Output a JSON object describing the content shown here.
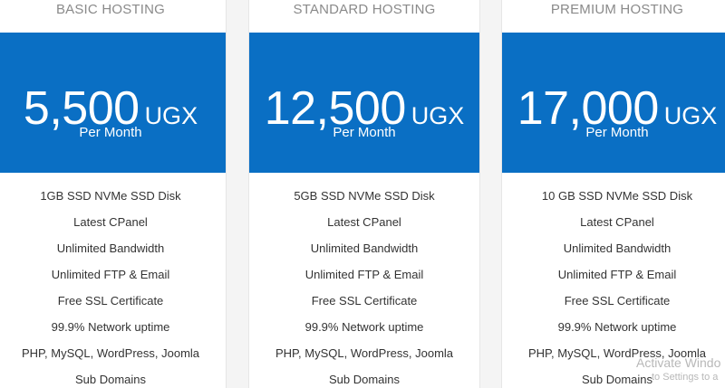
{
  "plans": [
    {
      "title": "BASIC HOSTING",
      "price": "5,500",
      "currency": "UGX",
      "period": "Per Month",
      "features": [
        "1GB SSD NVMe SSD Disk",
        "Latest CPanel",
        "Unlimited Bandwidth",
        "Unlimited FTP & Email",
        "Free SSL Certificate",
        "99.9% Network uptime",
        "PHP, MySQL, WordPress, Joomla",
        "Sub Domains"
      ]
    },
    {
      "title": "STANDARD HOSTING",
      "price": "12,500",
      "currency": "UGX",
      "period": "Per Month",
      "features": [
        "5GB SSD NVMe SSD Disk",
        "Latest CPanel",
        "Unlimited Bandwidth",
        "Unlimited FTP & Email",
        "Free SSL Certificate",
        "99.9% Network uptime",
        "PHP, MySQL, WordPress, Joomla",
        "Sub Domains"
      ]
    },
    {
      "title": "PREMIUM HOSTING",
      "price": "17,000",
      "currency": "UGX",
      "period": "Per Month",
      "features": [
        "10 GB SSD NVMe SSD Disk",
        "Latest CPanel",
        "Unlimited Bandwidth",
        "Unlimited FTP & Email",
        "Free SSL Certificate",
        "99.9% Network uptime",
        "PHP, MySQL, WordPress, Joomla",
        "Sub Domains"
      ]
    }
  ],
  "watermark": {
    "line1": "Activate Windo",
    "line2": "to Settings to a"
  },
  "colors": {
    "price_bg": "#0a6fc4",
    "title_text": "#8a8a8a",
    "feature_text": "#333333"
  }
}
